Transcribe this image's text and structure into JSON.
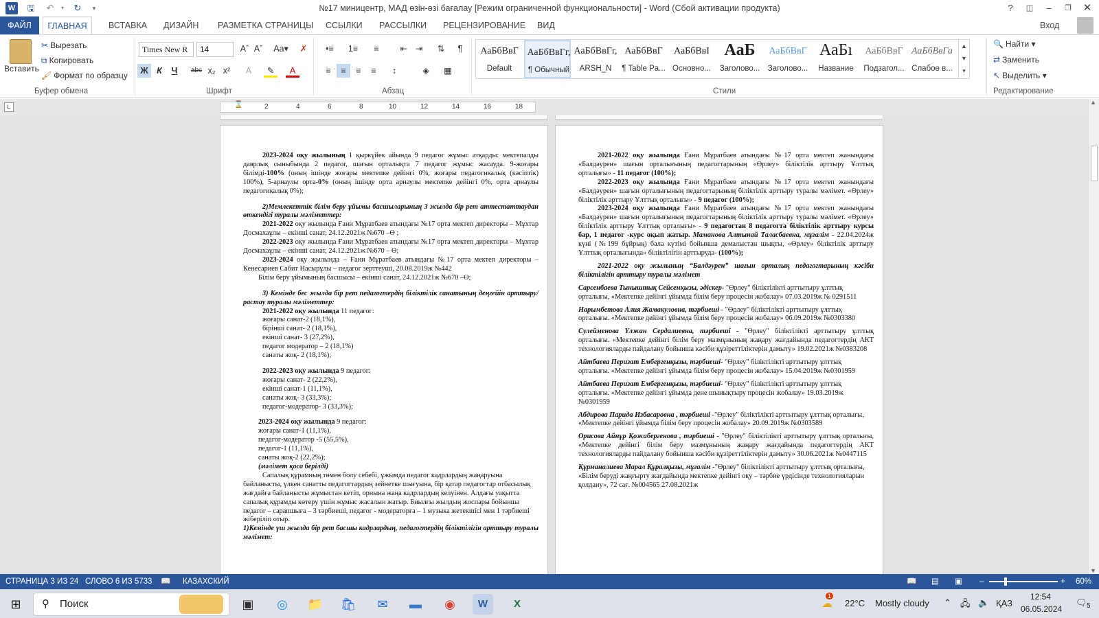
{
  "window": {
    "title": "№17 миницентр, МАД өзін-өзі бағалау [Режим ограниченной функциональности] - Word (Сбой активации продукта)",
    "signin": "Вход"
  },
  "tabs": [
    "ФАЙЛ",
    "ГЛАВНАЯ",
    "ВСТАВКА",
    "ДИЗАЙН",
    "РАЗМЕТКА СТРАНИЦЫ",
    "ССЫЛКИ",
    "РАССЫЛКИ",
    "РЕЦЕНЗИРОВАНИЕ",
    "ВИД"
  ],
  "ribbon": {
    "clipboard": {
      "paste": "Вставить",
      "cut": "Вырезать",
      "copy": "Копировать",
      "format_painter": "Формат по образцу",
      "label": "Буфер обмена"
    },
    "font": {
      "name": "Times New R",
      "size": "14",
      "label": "Шрифт"
    },
    "paragraph": {
      "label": "Абзац"
    },
    "styles": {
      "label": "Стили",
      "items": [
        {
          "preview": "АаБбВвГ",
          "name": "Default"
        },
        {
          "preview": "АаБбВвГг,",
          "name": "¶ Обычный"
        },
        {
          "preview": "АаБбВвГг,",
          "name": "ARSH_N"
        },
        {
          "preview": "АаБбВвГ",
          "name": "¶ Table Pa..."
        },
        {
          "preview": "АаБбВвІ",
          "name": "Основно..."
        },
        {
          "preview": "АаБ",
          "name": "Заголово..."
        },
        {
          "preview": "АаБбВвГ",
          "name": "Заголово..."
        },
        {
          "preview": "АаБı",
          "name": "Название"
        },
        {
          "preview": "АаБбВвГ",
          "name": "Подзагол..."
        },
        {
          "preview": "АаБбВвГа",
          "name": "Слабое в..."
        }
      ]
    },
    "editing": {
      "find": "Найти",
      "replace": "Заменить",
      "select": "Выделить",
      "label": "Редактирование"
    }
  },
  "ruler": {
    "numbers": [
      "2",
      "4",
      "6",
      "8",
      "10",
      "12",
      "14",
      "16",
      "18"
    ]
  },
  "page_left": {
    "p1_bold": "2023-2024 оқу жылының",
    "p1": " 1 қыркүйек айында 9 педагог жұмыс атқарды: мектепалды даярлық сыныбында 2 педагог, шағын орталықта  7 педагог жұмыс жасауда. 9-жоғары білімді-",
    "p1_b2": "100%",
    "p1_c": " (оның ішінде жоғары мектепке дейінгі 0%, жоғары педагогикалық (кәсіптік) 100%), 5-арнаулы орта-",
    "p1_b3": "0%",
    "p1_d": " (оның ішінде орта арнаулы мектепке дейінгі 0%, орта арнаулы педагогикалық 0%);",
    "h2": "2)Мемлекеттік білім беру ұйымы басшыларының 3 жылда бір рет аттестаттаудан өткендігі туралы мәліметтер:",
    "d1_b": "2021-2022",
    "d1": " оқу жылында Ғани Мұратбаев атындағы №17 орта мектеп директоры – Мұхтар Досмахаұлы – екінші санат, 24.12.2021ж №670 –Ө ;",
    "d2_b": "2022-2023",
    "d2": " оқу жылында Ғани Мұратбаев атындағы №17 орта мектеп директоры – Мұхтар Досмахаұлы – екінші санат, 24.12.2021ж №670 – Ө;",
    "d3_b": "2023-2024",
    "d3": " оқу жылында – Ғани Мұратбаев атындағы №17 орта мектеп директоры – Кенесариев Сабит Насырұлы –  педагог зерттеуші, 20.08.2019ж №442",
    "d4": "Білім беру ұйымының басшысы – екінші санат, 24.12.2021ж №670 –Ө;",
    "h3": "3) Кемінде бес жылда бір рет педагогтердің біліктілік санатының деңгейін арттыру/растау туралы мәліметтер:",
    "y1_b": "2021-2022 оқу жылында",
    "y1": " 11 педагог:",
    "y1_items": [
      "жоғары санат-2 (18,1%),",
      "бірінші санат- 2 (18,1%),",
      "екінші санат- 3 (27,2%),",
      " педагог модератор – 2 (18,1%)",
      "санаты жоқ- 2 (18,1%);"
    ],
    "y2_b": "2022-2023 оқу жылында",
    "y2": " 9 педагог:",
    "y2_items": [
      " жоғары санат- 2 (22,2%),",
      " екінші санат-1 (11,1%),",
      "санаты жоқ- 3 (33,3%);",
      "педагог-модератор- 3 (33,3%);"
    ],
    "y3_b": "2023-2024 оқу жылында",
    "y3": " 9 педагог:",
    "y3_items": [
      "жоғары санат-1 (11,1%),",
      "педагог-модератор -5 (55,5%),",
      "педагог-1 (11,1%),",
      "санаты жоқ-2 (22,2%);"
    ],
    "note": " (мәлімет қоса берілді)",
    "para": "Сапалық құрамның төмен болу себебі, ұжымда педагог кадрлардың жаңаруына байланысты, үлкен санатты педагогтардың зейнетке шығуына, бір қатар педагогтар отбасылық жағдайға байланысты  жұмыстан кетіп,  орнына жаңа кадрлардың келуінен. Алдағы уақытта сапалық құрамды көтеру үшін жұмыс жасалын жатыр.  Биылғы жылдың жоспары бойынша педагог – сарапшыға – 3 тәрбиеші, педагог - модераторға – 1 музыка жетекшісі мен 1 тәрбиеші  жіберіліп отыр.",
    "h4": "1)Кемінде үш жылда бір рет басшы кадрлардың, педагогтердің біліктілігін арттыру туралы мәлімет:"
  },
  "page_right": {
    "r1_b": "2021-2022 оқу жылында",
    "r1": " Ғани Мұратбаев атындағы №17 орта мектеп жанындағы «Балдәурен» шағын орталығының педагогтарының  «Өрлеу» біліктілік арттыру Ұлттық орталығы»  - ",
    "r1_e": "11 педагог (100%);",
    "r2_b": "2022-2023 оқу жылында",
    "r2": " Ғани Мұратбаев атындағы №17 орта мектеп жанындағы «Балдәурен» шағын орталығының педагогтарының біліктілік арттыру туралы мәлімет. «Өрлеу» біліктілік арттыру Ұлттық орталығы»  - ",
    "r2_e": "9 педагог (100%);",
    "r3_b": "2023-2024 оқу жылында",
    "r3": " Ғани Мұратбаев атындағы №17 орта мектеп жанындағы «Балдәурен» шағын орталығының педагогтарының біліктілік арттыру туралы мәлімет. «Өрлеу» біліктілік арттыру Ұлттық орталығы»  - ",
    "r3_e": "9 педагогтан 8 педагогта біліктілік арттыру курсы бар, 1 педагог -курс оқып жатыр.",
    "r3_i": " Маманова Алтынай Таласбаевна, мұғалім -",
    "r3_f": "  22.04.2024ж күні (№199 бұйрық) бала күтімі бойынша демалыстан шықты, «Өрлеу» біліктілік арттыру Ұлттық орталығында»  біліктілігін арттыруда- ",
    "r3_g": "(100%);",
    "h": "2021-2022 оқу жылының “Балдәурен” шағын орталық педагогтарының кәсіби біліктілігін арттыру туралы мәлімет",
    "entries": [
      {
        "name": "Сарсенбаева Тыныштық Сейсенқызы, әдіскер-",
        "text": " \"Өрлеу\" біліктілікті арттытыру ұлттық орталығы, «Мектепке дейінгі ұйымда білім беру процесін жобалау» 07.03.2019ж № 0291511"
      },
      {
        "name": "Нарымбетова Алия Жамакуловна, тәрбиеші -",
        "text": " \"Өрлеу\" біліктілікті арттытыру ұлттық орталығы. «Мектепке дейінгі ұйымда білім беру процесін жобалау» 06.09.2019ж №0303380"
      },
      {
        "name": "Сулейменова Үлжан Сердалиевна, тәрбиеші -",
        "text": " \"Өрлеу\" біліктілікті арттытыру ұлттық орталығы. «Мектепке дейінгі білім беру мазмұнының жаңару жағдайында педагогтердің АКТ технологияларды пайдалану бойынша кәсіби құзіреттіліктерін дамыту» 19.02.2021ж  №0383208"
      },
      {
        "name": "Айтбаева Перизат Ембергенқызы, тәрбиеші-",
        "text": " \"Өрлеу\" біліктілікті арттытыру ұлттық орталығы. «Мектепке дейінгі ұйымда білім беру процесін жобалау»  15.04.2019ж №0301959"
      },
      {
        "name": "Айтбаева Перизат Ембергенқызы, тәрбиеші-",
        "text": " \"Өрлеу\" біліктілікті арттытыру ұлттық орталығы. «Мектепке дейінгі ұйымда дене шынықтыру процесін жобалау»  19.03.2019ж №0301959"
      },
      {
        "name": "Абдирова Парида Избасаровна , тәрбиеші -",
        "text": "\"Өрлеу\" біліктілікті арттытыру ұлттық орталығы,  «Мектепке дейінгі ұйымда білім беру процесін жобалау» 20.09.2019ж №0303589"
      },
      {
        "name": "Орисова Айнұр Қожабергенова , тәрбиеші -",
        "text": " \"Өрлеу\" біліктілікті арттытыру ұлттық орталығы, «Мектепке дейінгі білім беру мазмұнының жаңару жағдайында педагогтердің АКТ технологияларды пайдалану бойынша кәсіби құзіреттіліктерін дамыту» 30.06.2021ж  №0447115"
      },
      {
        "name": "Құрманалиева Марал Құралқызы, мұғалім -",
        "text": "\"Өрлеу\" біліктілікті арттытыру ұлттық орталығы, «Білім беруді жаңғырту жағдайында мектепке дейінгі оқу – тәрбие үрдісінде технологияларын қолдану», 72 сағ. №004565  27.08.2021ж"
      }
    ]
  },
  "status": {
    "page": "СТРАНИЦА 3 ИЗ 24",
    "words": "СЛОВО 6 ИЗ 5733",
    "language": "КАЗАХСКИЙ",
    "zoom": "60%"
  },
  "taskbar": {
    "search_placeholder": "Поиск",
    "weather_temp": "22°C",
    "weather_desc": "Mostly cloudy",
    "language": "ҚАЗ",
    "time": "12:54",
    "date": "06.05.2024",
    "notif_count": "5",
    "weather_badge": "1"
  }
}
